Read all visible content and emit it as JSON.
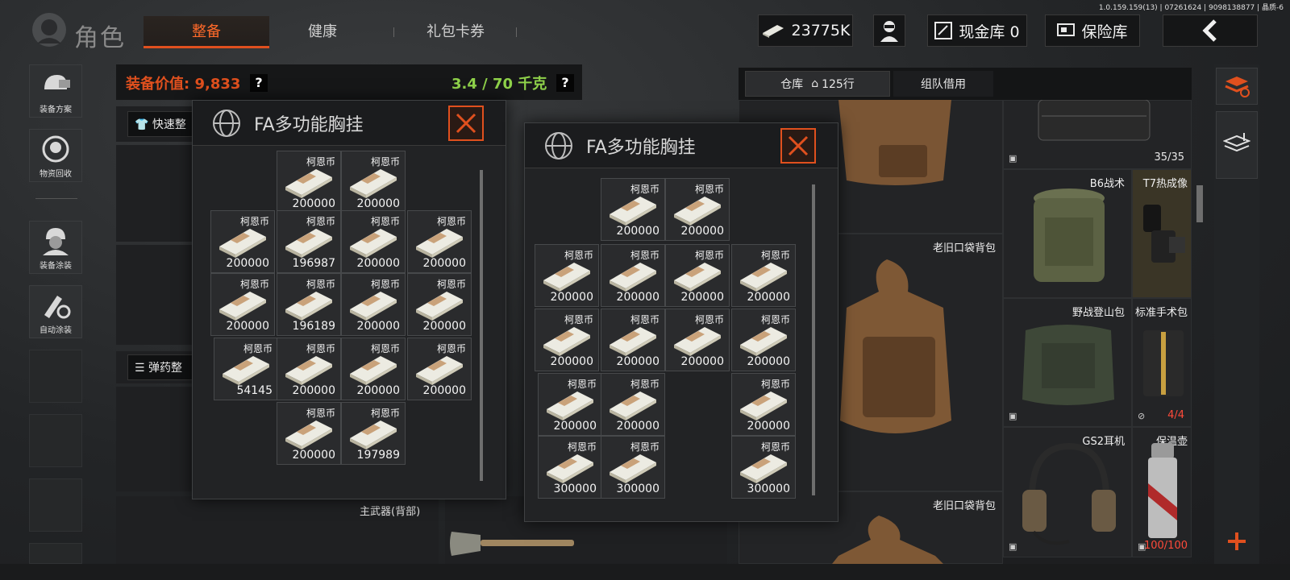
{
  "version": "1.0.159.159(13) | 07261624 | 9098138877 | 晶质-6",
  "header": {
    "title": "角色",
    "tabs": [
      {
        "label": "整备",
        "active": true
      },
      {
        "label": "健康",
        "active": false
      },
      {
        "label": "礼包卡券",
        "active": false
      }
    ],
    "currency": "23775K",
    "cash_vault": "现金库 0",
    "safe": "保险库",
    "back_icon": "chevron-left-icon"
  },
  "sidebar": [
    {
      "label": "装备方案",
      "icon": "helmet-icon"
    },
    {
      "label": "物资回收",
      "icon": "recycle-icon"
    },
    {
      "label": "装备涂装",
      "icon": "soldier-icon"
    },
    {
      "label": "自动涂装",
      "icon": "brush-gear-icon"
    }
  ],
  "equipment": {
    "value_label": "装备价值: 9,833",
    "weight": "3.4 / 70 千克",
    "help": "?",
    "quick_btn": "快速整",
    "ammo_btn": "弹药整",
    "primary_weapon": "主武器(背部)"
  },
  "warehouse": {
    "tab_warehouse": "仓库",
    "rows": "125行",
    "tab_team": "组队借用",
    "items": [
      {
        "name": "",
        "count": "35/35"
      },
      {
        "name": "B6战术",
        "count": ""
      },
      {
        "name": "T7热成像",
        "count": ""
      },
      {
        "name": "老旧口袋背包",
        "count": ""
      },
      {
        "name": "野战登山包",
        "count": ""
      },
      {
        "name": "标准手术包",
        "count": "4/4"
      },
      {
        "name": "GS2耳机",
        "count": ""
      },
      {
        "name": "保温壶",
        "count": "100/100"
      },
      {
        "name": "老旧口袋背包",
        "count": ""
      }
    ]
  },
  "rig_left": {
    "title": "FA多功能胸挂",
    "item_name": "柯恩币",
    "cells": [
      "200000",
      "200000",
      "200000",
      "196987",
      "200000",
      "200000",
      "200000",
      "196189",
      "200000",
      "200000",
      "54145",
      "200000",
      "200000",
      "200000",
      "200000",
      "197989"
    ]
  },
  "rig_right": {
    "title": "FA多功能胸挂",
    "item_name": "柯恩币",
    "cells": [
      "200000",
      "200000",
      "200000",
      "200000",
      "200000",
      "200000",
      "200000",
      "200000",
      "200000",
      "200000",
      "200000",
      "200000",
      "200000",
      "300000",
      "300000",
      "300000"
    ]
  },
  "colors": {
    "accent": "#e0501e",
    "weight_ok": "#8fd24a",
    "danger": "#ff4a3a"
  }
}
